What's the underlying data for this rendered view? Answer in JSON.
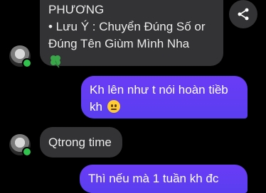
{
  "messages": [
    {
      "sender": "other",
      "lines": [
        "PHƯƠNG",
        "• Lưu Ý : Chuyển Đúng Số or",
        "Đúng Tên Giùm Mình Nha"
      ],
      "emoji": "four-leaf-clover"
    },
    {
      "sender": "me",
      "lines": [
        "Kh lên như t nói hoàn tiềb",
        "kh"
      ],
      "emoji": "grimacing-face"
    },
    {
      "sender": "other",
      "lines": [
        "Qtrong time"
      ]
    },
    {
      "sender": "me",
      "lines": [
        "Thì nếu mà 1 tuần kh đc"
      ]
    }
  ],
  "colors": {
    "incoming_bubble": "#333335",
    "outgoing_bubble": "#5a3ef0",
    "online_dot": "#31c24d",
    "background": "#000000"
  },
  "icons": {
    "share": "share-icon",
    "clover": "four-leaf-clover-icon"
  }
}
